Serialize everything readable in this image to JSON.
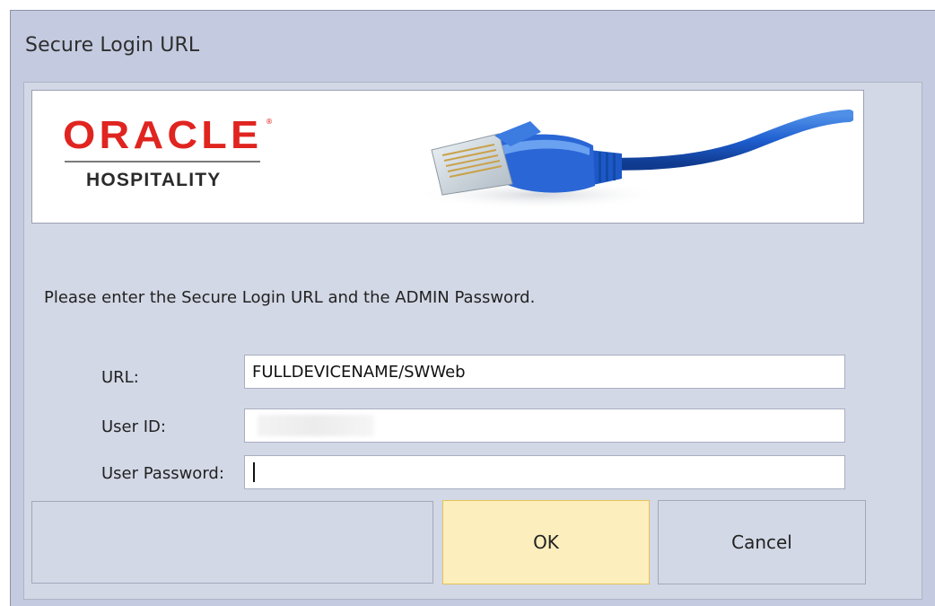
{
  "window": {
    "title": "Secure Login URL"
  },
  "banner": {
    "brand": "ORACLE",
    "registered_mark": "®",
    "sub_brand": "HOSPITALITY",
    "image": "network-cable-image",
    "brand_color": "#e0241f"
  },
  "form": {
    "prompt": "Please enter the Secure Login URL and the ADMIN Password.",
    "url_label": "URL:",
    "url_value": "FULLDEVICENAME/SWWeb",
    "user_id_label": "User ID:",
    "user_id_value": "",
    "password_label": "User Password:",
    "password_value": ""
  },
  "buttons": {
    "ok_label": "OK",
    "cancel_label": "Cancel"
  },
  "colors": {
    "window_bg": "#c4cbe0",
    "panel_bg": "#d3d8e6",
    "ok_highlight": "#fcefbd"
  }
}
